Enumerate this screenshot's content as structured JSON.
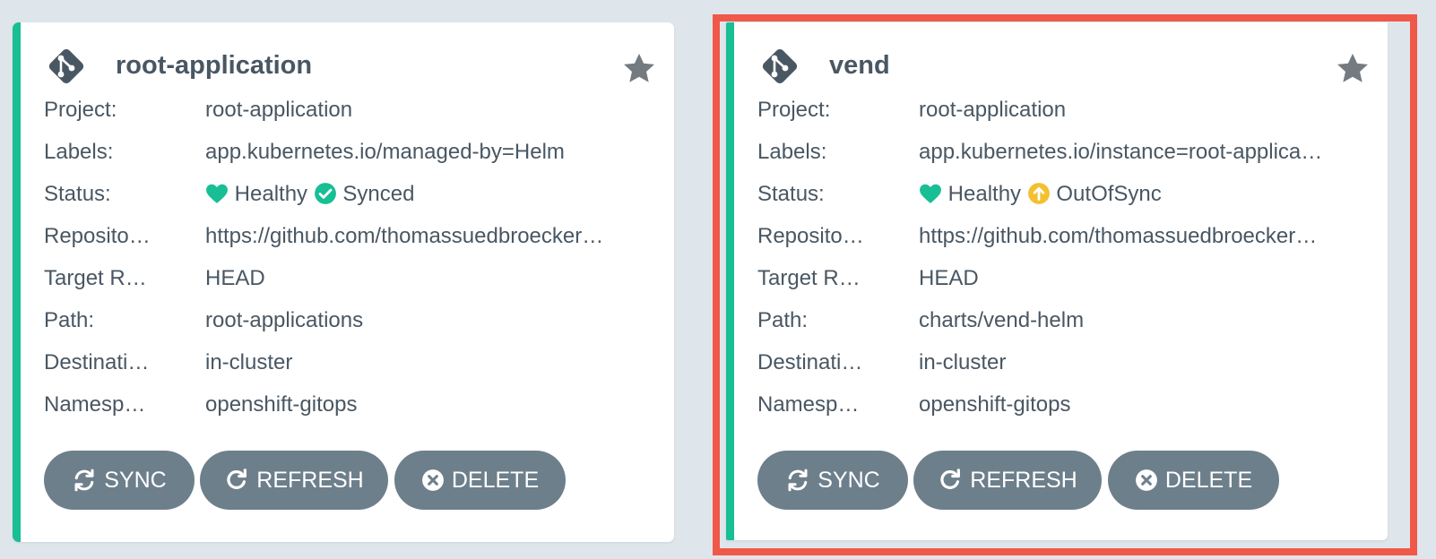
{
  "colors": {
    "background": "#dee6eb",
    "card": "#ffffff",
    "accent_healthy": "#18be94",
    "synced": "#18be94",
    "out_of_sync": "#f4c030",
    "button": "#6d7f8b",
    "highlight": "#f0594a",
    "text": "#495763"
  },
  "cards": [
    {
      "name": "root-application",
      "labels_text": {
        "project": "Project:",
        "labels": "Labels:",
        "status": "Status:",
        "repository": "Reposito…",
        "target_revision": "Target R…",
        "path": "Path:",
        "destination": "Destinati…",
        "namespace": "Namesp…"
      },
      "project": "root-application",
      "labels": "app.kubernetes.io/managed-by=Helm",
      "health": "Healthy",
      "sync_status": "Synced",
      "repository": "https://github.com/thomassuedbroecker…",
      "target_revision": "HEAD",
      "path": "root-applications",
      "destination": "in-cluster",
      "namespace": "openshift-gitops",
      "buttons": {
        "sync": "SYNC",
        "refresh": "REFRESH",
        "delete": "DELETE"
      }
    },
    {
      "name": "vend",
      "labels_text": {
        "project": "Project:",
        "labels": "Labels:",
        "status": "Status:",
        "repository": "Reposito…",
        "target_revision": "Target R…",
        "path": "Path:",
        "destination": "Destinati…",
        "namespace": "Namesp…"
      },
      "project": "root-application",
      "labels": "app.kubernetes.io/instance=root-applica…",
      "health": "Healthy",
      "sync_status": "OutOfSync",
      "repository": "https://github.com/thomassuedbroecker…",
      "target_revision": "HEAD",
      "path": "charts/vend-helm",
      "destination": "in-cluster",
      "namespace": "openshift-gitops",
      "buttons": {
        "sync": "SYNC",
        "refresh": "REFRESH",
        "delete": "DELETE"
      }
    }
  ]
}
